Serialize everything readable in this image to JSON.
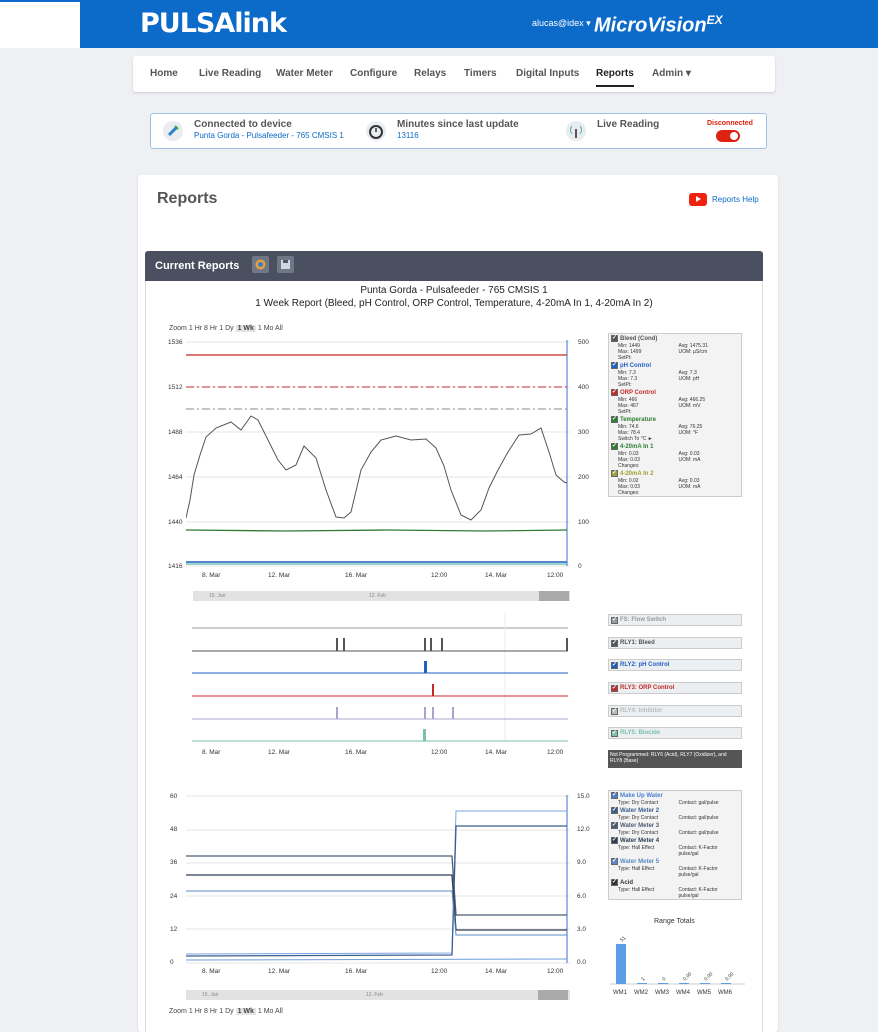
{
  "header": {
    "logo": "PULSAlink",
    "user": "alucas@idex ▾",
    "product": "MicroVision",
    "product_sup": "EX"
  },
  "nav": {
    "items": [
      "Home",
      "Live Reading",
      "Water Meter",
      "Configure",
      "Relays",
      "Timers",
      "Digital Inputs",
      "Reports",
      "Admin ▾"
    ],
    "active": "Reports"
  },
  "status": {
    "connected_label": "Connected to device",
    "connected_value": "Punta Gorda - Pulsafeeder - 765 CMSIS 1",
    "minutes_label": "Minutes since last update",
    "minutes_value": "13116",
    "live_label": "Live Reading",
    "live_state": "Disconnected"
  },
  "page": {
    "title": "Reports",
    "help": "Reports Help"
  },
  "panel": {
    "title": "Current Reports"
  },
  "chart1": {
    "title_line1": "Punta Gorda - Pulsafeeder - 765 CMSIS 1",
    "title_line2": "1 Week Report (Bleed, pH Control, ORP Control, Temperature, 4-20mA In 1, 4-20mA In 2)"
  },
  "zoom": {
    "label": "Zoom",
    "options": [
      "1 Hr",
      "8 Hr",
      "1 Dy",
      "1 Wk",
      "1 Mo",
      "All"
    ],
    "selected": "1 Wk"
  },
  "xticks": [
    "8. Mar",
    "12. Mar",
    "16. Mar",
    "12:00",
    "14. Mar",
    "12:00"
  ],
  "navigator_top": [
    "15. Jan",
    "12. Feb"
  ],
  "chart_data": [
    {
      "type": "line",
      "yleft": {
        "ticks": [
          "1536",
          "1512",
          "1488",
          "1464",
          "1440",
          "1416"
        ]
      },
      "yright": {
        "ticks": [
          "500",
          "400",
          "300",
          "200",
          "100",
          "0"
        ]
      },
      "series": [
        {
          "name": "Bleed (Cond)",
          "min": "1449",
          "max": "1499",
          "avg": "1475.31",
          "unit": "µS/cm",
          "color": "#555555"
        },
        {
          "name": "pH Control",
          "min": "7.3",
          "max": "7.3",
          "avg": "7.3",
          "unit": "pH",
          "color": "#1f5fc4"
        },
        {
          "name": "ORP Control",
          "min": "466",
          "max": "467",
          "avg": "466.25",
          "unit": "mV",
          "color": "#c62828"
        },
        {
          "name": "Temperature",
          "min": "74.6",
          "max": "78.4",
          "avg": "76.25",
          "unit": "°F",
          "color": "#2e7d32"
        },
        {
          "name": "4-20mA In 1",
          "min": "0.03",
          "max": "0.03",
          "avg": "0.03",
          "unit": "mA"
        },
        {
          "name": "4-20mA In 2",
          "min": "0.02",
          "max": "0.03",
          "avg": "0.03",
          "unit": "mA"
        }
      ]
    },
    {
      "type": "line",
      "yleft": {
        "ticks": [
          "60",
          "48",
          "36",
          "24",
          "12",
          "0"
        ]
      },
      "yright": {
        "ticks": [
          "15.0",
          "12.0",
          "9.0",
          "6.0",
          "3.0",
          "0.0"
        ]
      },
      "series": [
        {
          "name": "Make Up Water"
        },
        {
          "name": "Water Meter 2"
        },
        {
          "name": "Water Meter 3"
        },
        {
          "name": "Water Meter 4"
        },
        {
          "name": "Water Meter 5"
        },
        {
          "name": "Acid"
        }
      ]
    },
    {
      "type": "bar",
      "title": "Range Totals",
      "categories": [
        "WM1",
        "WM2",
        "WM3",
        "WM4",
        "WM5",
        "WM6"
      ],
      "values": [
        51,
        1,
        0,
        0,
        0,
        0
      ],
      "labels": [
        "51",
        "1",
        "0",
        "0.00",
        "0.00",
        "0.00"
      ]
    }
  ],
  "legend1": [
    {
      "name": "Bleed (Cond)",
      "color": "#555555",
      "r1a": "Min: 1449",
      "r1b": "Avg: 1475.31",
      "r2a": "Max: 1499",
      "r2b": "UOM: µS/cm",
      "r3": "SetPt:"
    },
    {
      "name": "pH Control",
      "color": "#1f5fc4",
      "r1a": "Min: 7.3",
      "r1b": "Avg: 7.3",
      "r2a": "Max: 7.3",
      "r2b": "UOM: pH",
      "r3": "SetPt:"
    },
    {
      "name": "ORP Control",
      "color": "#c62828",
      "r1a": "Min: 466",
      "r1b": "Avg: 466.25",
      "r2a": "Max: 467",
      "r2b": "UOM: mV",
      "r3": "SetPt:"
    },
    {
      "name": "Temperature",
      "color": "#2e7d32",
      "r1a": "Min: 74.6",
      "r1b": "Avg: 76.25",
      "r2a": "Max: 78.4",
      "r2b": "UOM: °F",
      "r3": "Switch To °C ►"
    },
    {
      "name": "4-20mA In 1",
      "color": "#2e7d32",
      "r1a": "Min: 0.03",
      "r1b": "Avg: 0.03",
      "r2a": "Max: 0.03",
      "r2b": "UOM: mA",
      "r3": "Changes:"
    },
    {
      "name": "4-20mA In 2",
      "color": "#a0a030",
      "r1a": "Min: 0.02",
      "r1b": "Avg: 0.03",
      "r2a": "Max: 0.03",
      "r2b": "UOM: mA",
      "r3": "Changes:"
    }
  ],
  "relays": [
    "FS: Flow Switch",
    "RLY1: Bleed",
    "RLY2: pH Control",
    "RLY3: ORP Control",
    "RLY4: Inhibitor",
    "RLY5: Biocide"
  ],
  "relay_note": "Not Programmed: RLY6 (Acid), RLY7 (Oxidizer), and RLY8 (Base)",
  "legend3": [
    {
      "name": "Make Up Water",
      "type": "Type: Dry Contact",
      "contact": "Contact: gal/pulse"
    },
    {
      "name": "Water Meter 2",
      "type": "Type: Dry Contact",
      "contact": "Contact: gal/pulse"
    },
    {
      "name": "Water Meter 3",
      "type": "Type: Dry Contact",
      "contact": "Contact: gal/pulse"
    },
    {
      "name": "Water Meter 4",
      "type": "Type: Hall Effect",
      "contact": "Contact: K-Factor pulse/gal"
    },
    {
      "name": "Water Meter 5",
      "type": "Type: Hall Effect",
      "contact": "Contact: K-Factor pulse/gal"
    },
    {
      "name": "Acid",
      "type": "Type: Hall Effect",
      "contact": "Contact: K-Factor pulse/gal"
    }
  ]
}
